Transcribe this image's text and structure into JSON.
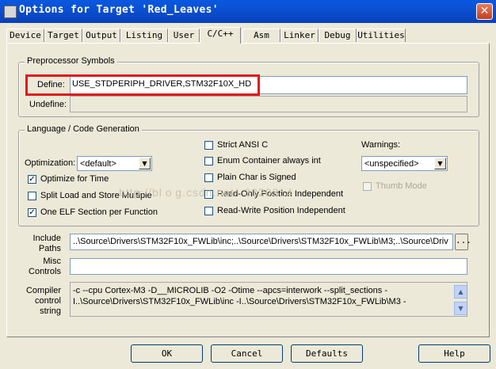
{
  "window": {
    "title": "Options for Target 'Red_Leaves'",
    "close": "✕"
  },
  "tabs": [
    {
      "label": "Device"
    },
    {
      "label": "Target"
    },
    {
      "label": "Output"
    },
    {
      "label": "Listing"
    },
    {
      "label": "User"
    },
    {
      "label": "C/C++"
    },
    {
      "label": "Asm"
    },
    {
      "label": "Linker"
    },
    {
      "label": "Debug"
    },
    {
      "label": "Utilities"
    }
  ],
  "preprocessor": {
    "group_label": "Preprocessor Symbols",
    "define_label": "Define:",
    "define_value": "USE_STDPERIPH_DRIVER,STM32F10X_HD",
    "undefine_label": "Undefine:",
    "undefine_value": ""
  },
  "language": {
    "group_label": "Language / Code Generation",
    "optimization_label": "Optimization:",
    "optimization_value": "<default>",
    "optimize_time": "Optimize for Time",
    "split_load": "Split Load and Store Multiple",
    "one_elf": "One ELF Section per Function",
    "strict_ansi": "Strict ANSI C",
    "enum_container": "Enum Container always int",
    "plain_char": "Plain Char is Signed",
    "ro_pos": "Read-Only Position Independent",
    "rw_pos": "Read-Write Position Independent",
    "warnings_label": "Warnings:",
    "warnings_value": "<unspecified>",
    "thumb_mode": "Thumb Mode",
    "check": "✓",
    "dropdown": "▼"
  },
  "include": {
    "label_line1": "Include",
    "label_line2": "Paths",
    "value": "..\\Source\\Drivers\\STM32F10x_FWLib\\inc;..\\Source\\Drivers\\STM32F10x_FWLib\\M3;..\\Source\\Driv",
    "browse": "..."
  },
  "misc": {
    "label_line1": "Misc",
    "label_line2": "Controls",
    "value": ""
  },
  "compiler": {
    "label_line1": "Compiler",
    "label_line2": "control",
    "label_line3": "string",
    "line1": "-c --cpu Cortex-M3 -D__MICROLIB -O2 -Otime --apcs=interwork --split_sections -",
    "line2": "I..\\Source\\Drivers\\STM32F10x_FWLib\\inc -I..\\Source\\Drivers\\STM32F10x_FWLib\\M3 -",
    "scroll_up": "▲",
    "scroll_down": "▼"
  },
  "watermark": "http://bl o g.csdn.net/  3320314",
  "buttons": {
    "ok": "OK",
    "cancel": "Cancel",
    "defaults": "Defaults",
    "help": "Help"
  }
}
